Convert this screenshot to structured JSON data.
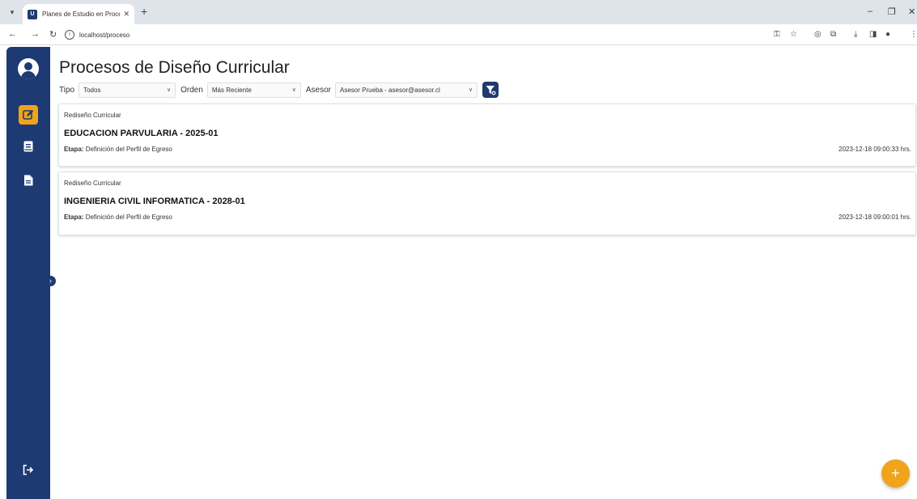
{
  "browser": {
    "tab_title": "Planes de Estudio en Proceso -",
    "favicon_letter": "U",
    "url": "localhost/proceso"
  },
  "page": {
    "title": "Procesos de Diseño Curricular"
  },
  "filters": {
    "tipo_label": "Tipo",
    "tipo_value": "Todos",
    "orden_label": "Orden",
    "orden_value": "Más Reciente",
    "asesor_label": "Asesor",
    "asesor_value": "Asesor Prueba - asesor@asesor.cl"
  },
  "cards": [
    {
      "type": "Rediseño Curricular",
      "name": "EDUCACION PARVULARIA - 2025-01",
      "stage_label": "Etapa:",
      "stage_value": "Definición del Perfil de Egreso",
      "date": "2023-12-18 09:00:33 hrs."
    },
    {
      "type": "Rediseño Curricular",
      "name": "INGENIERIA CIVIL INFORMATICA - 2028-01",
      "stage_label": "Etapa:",
      "stage_value": "Definición del Perfil de Egreso",
      "date": "2023-12-18 09:00:01 hrs."
    }
  ],
  "fab": {
    "label": "+"
  },
  "colors": {
    "sidebar": "#1e3a73",
    "accent": "#f0a41b"
  },
  "icons": [
    "user-avatar-icon",
    "edit-icon",
    "book-icon",
    "document-icon",
    "logout-icon",
    "filter-icon",
    "plus-icon"
  ]
}
